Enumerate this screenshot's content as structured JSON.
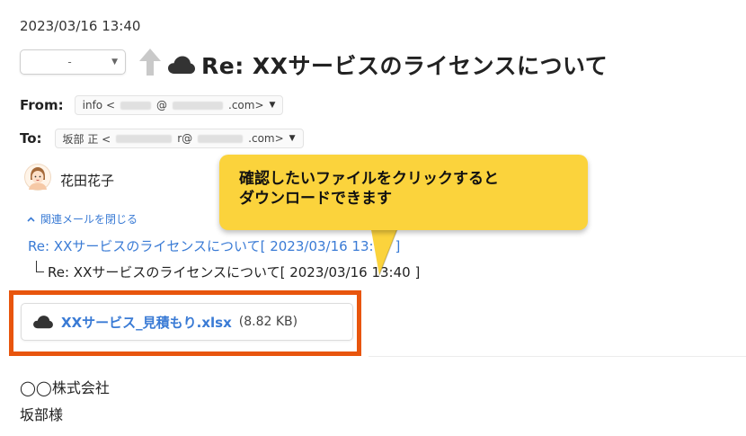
{
  "datetime": "2023/03/16 13:40",
  "toolbar": {
    "select_value": "-",
    "up_icon": "arrow-up-icon"
  },
  "subject": {
    "icon": "cloud-icon",
    "title": "Re: XXサービスのライセンスについて"
  },
  "from": {
    "label": "From:",
    "prefix": "info <",
    "suffix": ".com>",
    "at": "@"
  },
  "to": {
    "label": "To:",
    "prefix": "坂部 正 <",
    "mid": "r@",
    "suffix": ".com>"
  },
  "sender": {
    "name": "花田花子",
    "avatar_icon": "person-avatar-icon"
  },
  "related": {
    "toggle_label": "関連メールを閉じる",
    "link_text": "Re: XXサービスのライセンスについて[ 2023/03/16 13:05 ]",
    "current_text": "Re: XXサービスのライセンスについて[ 2023/03/16 13:40 ]"
  },
  "attachment": {
    "icon": "cloud-icon",
    "name": "XXサービス_見積もり.xlsx",
    "size": "(8.82 KB)"
  },
  "body": {
    "line1": "◯◯株式会社",
    "line2": "坂部様"
  },
  "callout": {
    "line1": "確認したいファイルをクリックすると",
    "line2": "ダウンロードできます"
  },
  "colors": {
    "link": "#3a7bd5",
    "highlight": "#e8550d",
    "callout_bg": "#fbd33c"
  }
}
